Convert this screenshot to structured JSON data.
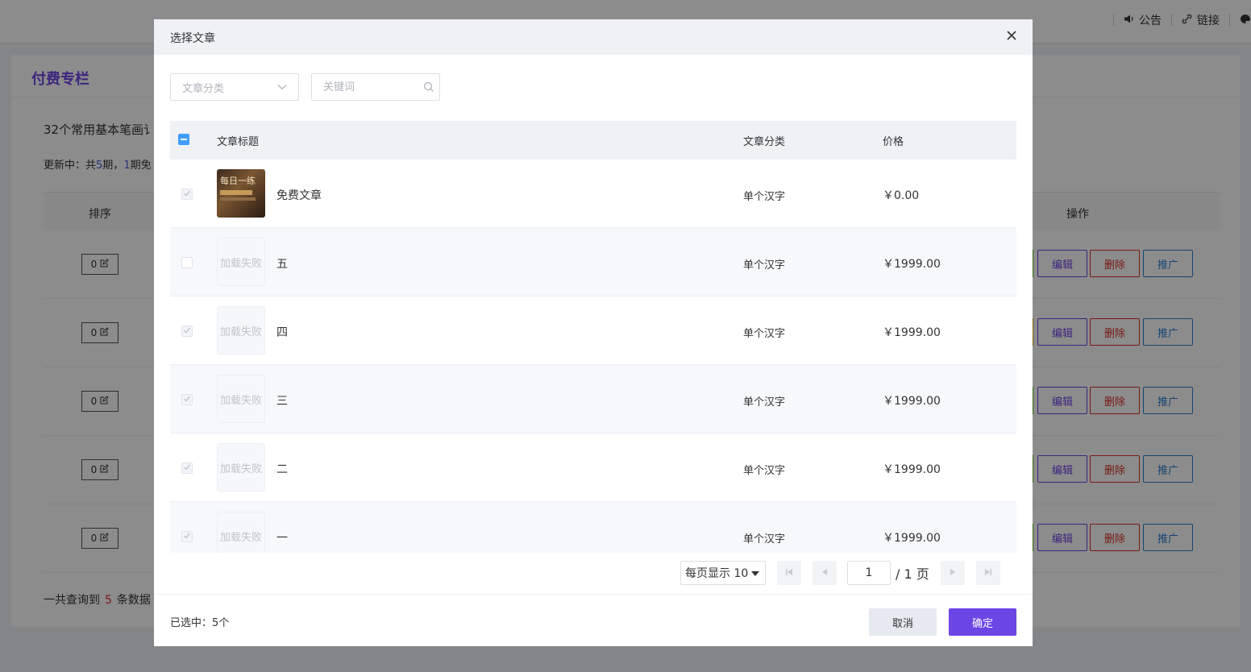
{
  "background": {
    "topbar_links": [
      {
        "icon": "speaker-icon",
        "label": "公告"
      },
      {
        "icon": "link-icon",
        "label": "链接"
      }
    ],
    "card_title": "付费专栏",
    "course_title": "32个常用基本笔画讠",
    "course_meta_prefix": "更新中：共",
    "course_meta_count": "5",
    "course_meta_mid": "期，",
    "course_meta_free": "1",
    "course_meta_suffix": "期免",
    "columns": {
      "sort": "排序",
      "actions": "操作"
    },
    "rows": [
      {
        "sort": "0",
        "edit": "编辑",
        "delete": "删除",
        "promote": "推广",
        "strip_color": "#52c41a"
      },
      {
        "sort": "0",
        "edit": "编辑",
        "delete": "删除",
        "promote": "推广",
        "strip_color": "#faad14"
      },
      {
        "sort": "0",
        "edit": "编辑",
        "delete": "删除",
        "promote": "推广",
        "strip_color": "#52c41a"
      },
      {
        "sort": "0",
        "edit": "编辑",
        "delete": "删除",
        "promote": "推广",
        "strip_color": "#52c41a"
      },
      {
        "sort": "0",
        "edit": "编辑",
        "delete": "删除",
        "promote": "推广",
        "strip_color": "#52c41a"
      }
    ],
    "total_prefix": "一共查询到",
    "total_count": "5",
    "total_suffix": "条数据"
  },
  "modal": {
    "title": "选择文章",
    "filters": {
      "category_placeholder": "文章分类",
      "keyword_placeholder": "关键词"
    },
    "table": {
      "headers": {
        "title": "文章标题",
        "category": "文章分类",
        "price": "价格"
      },
      "rows": [
        {
          "thumb_text": "每日一练",
          "load_failed": false,
          "title": "免费文章",
          "category": "单个汉字",
          "price": "￥0.00",
          "checked": true,
          "disabled": true
        },
        {
          "thumb_text": "加载失败",
          "load_failed": true,
          "title": "五",
          "category": "单个汉字",
          "price": "￥1999.00",
          "checked": false,
          "disabled": false
        },
        {
          "thumb_text": "加载失败",
          "load_failed": true,
          "title": "四",
          "category": "单个汉字",
          "price": "￥1999.00",
          "checked": true,
          "disabled": true
        },
        {
          "thumb_text": "加载失败",
          "load_failed": true,
          "title": "三",
          "category": "单个汉字",
          "price": "￥1999.00",
          "checked": true,
          "disabled": true
        },
        {
          "thumb_text": "加载失败",
          "load_failed": true,
          "title": "二",
          "category": "单个汉字",
          "price": "￥1999.00",
          "checked": true,
          "disabled": true
        },
        {
          "thumb_text": "加载失败",
          "load_failed": true,
          "title": "一",
          "category": "单个汉字",
          "price": "￥1999.00",
          "checked": true,
          "disabled": true
        }
      ]
    },
    "pagination": {
      "page_size_label": "每页显示 10",
      "current_page": "1",
      "total_pages_label": "/ 1 页"
    },
    "footer": {
      "selected_label": "已选中：5个",
      "cancel": "取消",
      "confirm": "确定"
    }
  },
  "colors": {
    "accent": "#6b46e5",
    "check_blue": "#409eff",
    "danger": "#d93026",
    "info": "#2a7fd4"
  }
}
